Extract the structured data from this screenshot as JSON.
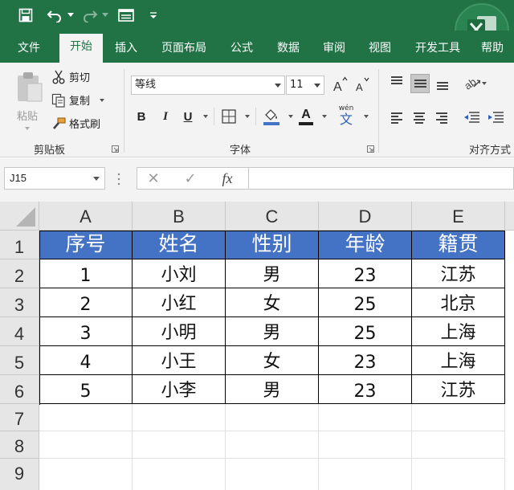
{
  "app": {
    "accent_color": "#217346",
    "header_fill_color": "#4472c4"
  },
  "quick_access": {
    "icons": [
      "save-icon",
      "undo-icon",
      "redo-icon",
      "form-icon",
      "customize-icon"
    ]
  },
  "ribbon_tabs": [
    "文件",
    "开始",
    "插入",
    "页面布局",
    "公式",
    "数据",
    "审阅",
    "视图",
    "开发工具",
    "帮助"
  ],
  "active_tab": "开始",
  "clipboard": {
    "paste_label": "粘贴",
    "cut_label": "剪切",
    "copy_label": "复制",
    "format_painter_label": "格式刷",
    "group_label": "剪贴板"
  },
  "font": {
    "name": "等线",
    "size": "11",
    "bold_label": "B",
    "italic_label": "I",
    "underline_label": "U",
    "font_color_label": "A",
    "phonetic_label": "wén",
    "phonetic_char": "文",
    "group_label": "字体"
  },
  "alignment": {
    "group_label": "对齐方式"
  },
  "formula_bar": {
    "name_box": "J15",
    "cancel_label": "✕",
    "enter_label": "✓",
    "fx_label": "fx",
    "content": ""
  },
  "sheet": {
    "columns": [
      "A",
      "B",
      "C",
      "D",
      "E"
    ],
    "rows": [
      "1",
      "2",
      "3",
      "4",
      "5",
      "6",
      "7",
      "8",
      "9"
    ],
    "header": [
      "序号",
      "姓名",
      "性别",
      "年龄",
      "籍贯"
    ],
    "data": [
      [
        "1",
        "小刘",
        "男",
        "23",
        "江苏"
      ],
      [
        "2",
        "小红",
        "女",
        "25",
        "北京"
      ],
      [
        "3",
        "小明",
        "男",
        "25",
        "上海"
      ],
      [
        "4",
        "小王",
        "女",
        "23",
        "上海"
      ],
      [
        "5",
        "小李",
        "男",
        "23",
        "江苏"
      ]
    ]
  }
}
